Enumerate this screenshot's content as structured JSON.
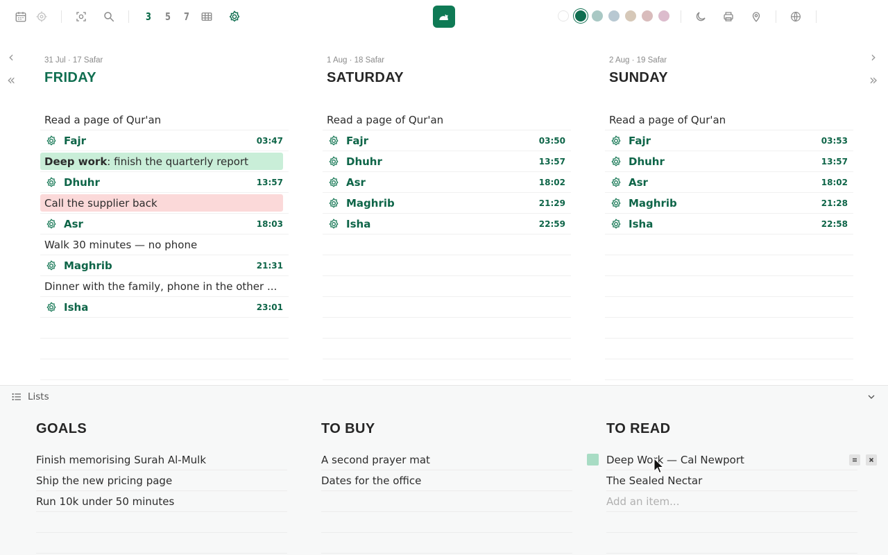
{
  "toolbar": {
    "icons": [
      "calendar-icon",
      "target-icon",
      "scan-icon",
      "search-icon",
      "grid-icon",
      "prayer-icon",
      "moon-icon",
      "printer-icon",
      "location-pin-icon",
      "globe-icon"
    ],
    "views": [
      "3",
      "5",
      "7"
    ],
    "active_view": "3",
    "swatches": [
      "#ffffff",
      "#0f6e50",
      "#a9c8c4",
      "#b8c8d2",
      "#d6c8b8",
      "#d9bcbc",
      "#dcbccd"
    ],
    "selected_swatch": "#0f6e50"
  },
  "days": [
    {
      "subtitle": "31 Jul · 17 Safar",
      "title": "FRIDAY",
      "today": true,
      "rows": [
        {
          "type": "note",
          "text": "Read a page of Qur'an"
        },
        {
          "type": "prayer",
          "name": "Fajr",
          "time": "03:47"
        },
        {
          "type": "note",
          "color": "green",
          "bold": "Deep work",
          "text": ": finish the quarterly report"
        },
        {
          "type": "prayer",
          "name": "Dhuhr",
          "time": "13:57"
        },
        {
          "type": "note",
          "color": "red",
          "text": "Call the supplier back"
        },
        {
          "type": "prayer",
          "name": "Asr",
          "time": "18:03"
        },
        {
          "type": "note",
          "text": "Walk 30 minutes — no phone"
        },
        {
          "type": "prayer",
          "name": "Maghrib",
          "time": "21:31"
        },
        {
          "type": "note",
          "text": "Dinner with the family, phone in the other ..."
        },
        {
          "type": "prayer",
          "name": "Isha",
          "time": "23:01"
        },
        {
          "type": "blank"
        },
        {
          "type": "blank"
        },
        {
          "type": "blank"
        }
      ]
    },
    {
      "subtitle": "1 Aug · 18 Safar",
      "title": "SATURDAY",
      "today": false,
      "rows": [
        {
          "type": "note",
          "text": "Read a page of Qur'an"
        },
        {
          "type": "prayer",
          "name": "Fajr",
          "time": "03:50"
        },
        {
          "type": "prayer",
          "name": "Dhuhr",
          "time": "13:57"
        },
        {
          "type": "prayer",
          "name": "Asr",
          "time": "18:02"
        },
        {
          "type": "prayer",
          "name": "Maghrib",
          "time": "21:29"
        },
        {
          "type": "prayer",
          "name": "Isha",
          "time": "22:59"
        },
        {
          "type": "blank"
        },
        {
          "type": "blank"
        },
        {
          "type": "blank"
        },
        {
          "type": "blank"
        },
        {
          "type": "blank"
        },
        {
          "type": "blank"
        },
        {
          "type": "blank"
        }
      ]
    },
    {
      "subtitle": "2 Aug · 19 Safar",
      "title": "SUNDAY",
      "today": false,
      "rows": [
        {
          "type": "note",
          "text": "Read a page of Qur'an"
        },
        {
          "type": "prayer",
          "name": "Fajr",
          "time": "03:53"
        },
        {
          "type": "prayer",
          "name": "Dhuhr",
          "time": "13:57"
        },
        {
          "type": "prayer",
          "name": "Asr",
          "time": "18:02"
        },
        {
          "type": "prayer",
          "name": "Maghrib",
          "time": "21:28"
        },
        {
          "type": "prayer",
          "name": "Isha",
          "time": "22:58"
        },
        {
          "type": "blank"
        },
        {
          "type": "blank"
        },
        {
          "type": "blank"
        },
        {
          "type": "blank"
        },
        {
          "type": "blank"
        },
        {
          "type": "blank"
        },
        {
          "type": "blank"
        }
      ]
    }
  ],
  "lists_panel": {
    "label": "Lists",
    "lists": [
      {
        "title": "GOALS",
        "items": [
          "Finish memorising Surah Al-Mulk",
          "Ship the new pricing page",
          "Run 10k under 50 minutes"
        ],
        "rows": 5
      },
      {
        "title": "TO BUY",
        "items": [
          "A second prayer mat",
          "Dates for the office"
        ],
        "rows": 5
      },
      {
        "title": "TO READ",
        "items": [
          "Deep Work — Cal Newport",
          "The Sealed Nectar"
        ],
        "placeholder": "Add an item...",
        "rows": 5
      }
    ]
  }
}
